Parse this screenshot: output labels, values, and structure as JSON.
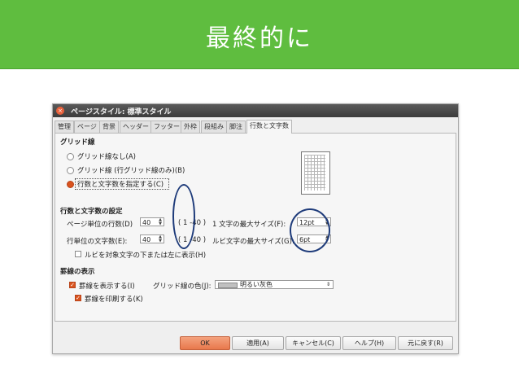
{
  "slide": {
    "title": "最終的に"
  },
  "dialog": {
    "title": "ページスタイル: 標準スタイル",
    "close_icon": "×",
    "tabs": [
      "管理",
      "ページ",
      "背景",
      "ヘッダー",
      "フッター",
      "外枠",
      "段組み",
      "脚注",
      "行数と文字数"
    ],
    "grid_section": {
      "heading": "グリッド線",
      "options": [
        "グリッド線なし(A)",
        "グリッド線 (行グリッド線のみ)(B)",
        "行数と文字数を指定する(C)"
      ],
      "selected": 2
    },
    "settings_section": {
      "heading": "行数と文字数の設定",
      "lines_per_page_label": "ページ単位の行数(D)",
      "lines_per_page_value": "40",
      "lines_range": "( 1 -40 )",
      "max_font_label": "1 文字の最大サイズ(F):",
      "max_font_value": "12pt",
      "chars_per_line_label": "行単位の文字数(E):",
      "chars_per_line_value": "40",
      "chars_range": "( 1 -40 )",
      "ruby_max_label": "ルビ文字の最大サイズ(G):",
      "ruby_max_value": "6pt",
      "ruby_below_label": "ルビを対象文字の下または左に表示(H)"
    },
    "lines_section": {
      "heading": "罫線の表示",
      "show_label": "罫線を表示する(I)",
      "color_label": "グリッド線の色(J):",
      "color_value": "明るい灰色",
      "print_label": "罫線を印刷する(K)"
    },
    "buttons": {
      "ok": "OK",
      "apply": "適用(A)",
      "cancel": "キャンセル(C)",
      "help": "ヘルプ(H)",
      "reset": "元に戻す(R)"
    }
  },
  "colors": {
    "header_green": "#5fbd3f",
    "accent_orange": "#d9531e",
    "annotation_blue": "#1e3b7a"
  }
}
